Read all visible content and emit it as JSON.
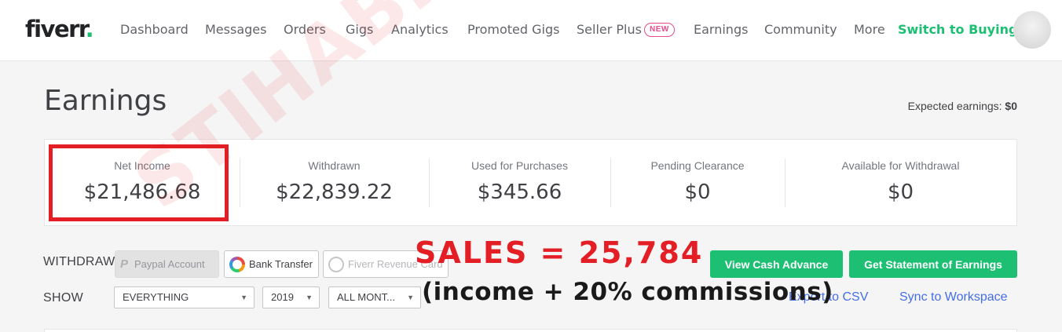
{
  "brand": {
    "logo": "fiverr",
    "logo_dot": ".",
    "accent": "#1dbf73"
  },
  "nav": {
    "items": [
      "Dashboard",
      "Messages",
      "Orders",
      "Gigs",
      "Analytics",
      "Promoted Gigs",
      "Seller Plus",
      "Earnings",
      "Community",
      "More"
    ],
    "new_badge": "NEW",
    "switch_label": "Switch to Buying"
  },
  "page": {
    "title": "Earnings",
    "expected_label": "Expected earnings:",
    "expected_value": "$0"
  },
  "stats": [
    {
      "label": "Net Income",
      "value": "$21,486.68"
    },
    {
      "label": "Withdrawn",
      "value": "$22,839.22"
    },
    {
      "label": "Used for Purchases",
      "value": "$345.66"
    },
    {
      "label": "Pending Clearance",
      "value": "$0"
    },
    {
      "label": "Available for Withdrawal",
      "value": "$0"
    }
  ],
  "withdraw": {
    "label": "WITHDRAW",
    "paypal": "Paypal Account",
    "bank": "Bank Transfer",
    "revenue_card": "Fiverr Revenue Card",
    "cash_advance": "View Cash Advance",
    "statement": "Get Statement of Earnings"
  },
  "show": {
    "label": "SHOW",
    "type_filter": "EVERYTHING",
    "year_filter": "2019",
    "month_filter": "ALL MONT...",
    "export": "Export to CSV",
    "sync": "Sync to Workspace"
  },
  "overlay": {
    "sales": "SALES = 25,784",
    "commission": "(income + 20% commissions)",
    "watermark": "STIHABIUC.COM",
    "highlight_color": "#e31e24"
  }
}
